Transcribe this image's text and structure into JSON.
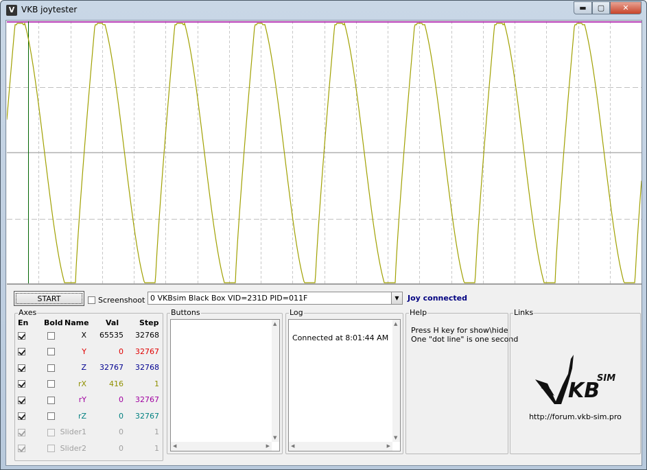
{
  "window": {
    "title": "VKB joytester",
    "icon": "vkb-v-icon"
  },
  "window_controls": {
    "minimize": "▬",
    "maximize": "▢",
    "close": "✕"
  },
  "plot": {
    "description_note": "",
    "trace_color": "#a0a000",
    "cursor_color": "#006400",
    "top_line_color": "#a000a0",
    "period_dotted_lines": 20
  },
  "toolbar": {
    "start_label": "START",
    "screenshoot_label": "Screenshoot",
    "screenshoot_checked": false,
    "device_value": "0 VKBsim Black Box  VID=231D PID=011F",
    "status_text": "Joy connected"
  },
  "axes": {
    "legend": "Axes",
    "headers": {
      "en": "En",
      "bold": "Bold",
      "name": "Name",
      "val": "Val",
      "step": "Step"
    },
    "rows": [
      {
        "name": "X",
        "val": "65535",
        "step": "32768",
        "color": "#000000",
        "en": true,
        "bold": false,
        "disabled": false
      },
      {
        "name": "Y",
        "val": "0",
        "step": "32767",
        "color": "#e00000",
        "en": true,
        "bold": false,
        "disabled": false
      },
      {
        "name": "Z",
        "val": "32767",
        "step": "32768",
        "color": "#000090",
        "en": true,
        "bold": false,
        "disabled": false
      },
      {
        "name": "rX",
        "val": "416",
        "step": "1",
        "color": "#909000",
        "en": true,
        "bold": false,
        "disabled": false
      },
      {
        "name": "rY",
        "val": "0",
        "step": "32767",
        "color": "#a000a0",
        "en": true,
        "bold": false,
        "disabled": false
      },
      {
        "name": "rZ",
        "val": "0",
        "step": "32767",
        "color": "#008080",
        "en": true,
        "bold": false,
        "disabled": false
      },
      {
        "name": "Slider1",
        "val": "0",
        "step": "1",
        "color": "#a0a0a0",
        "en": true,
        "bold": false,
        "disabled": true
      },
      {
        "name": "Slider2",
        "val": "0",
        "step": "1",
        "color": "#a0a0a0",
        "en": true,
        "bold": false,
        "disabled": true
      }
    ]
  },
  "buttons_panel": {
    "legend": "Buttons"
  },
  "log_panel": {
    "legend": "Log",
    "lines": [
      "Connected at 8:01:44 AM"
    ]
  },
  "help_panel": {
    "legend": "Help",
    "line1": "Press H key for show\\hide",
    "line2": "One \"dot line\" is one second"
  },
  "links_panel": {
    "legend": "Links",
    "logo_text": "KB",
    "logo_superscript": "SIM",
    "url": "http://forum.vkb-sim.pro"
  }
}
